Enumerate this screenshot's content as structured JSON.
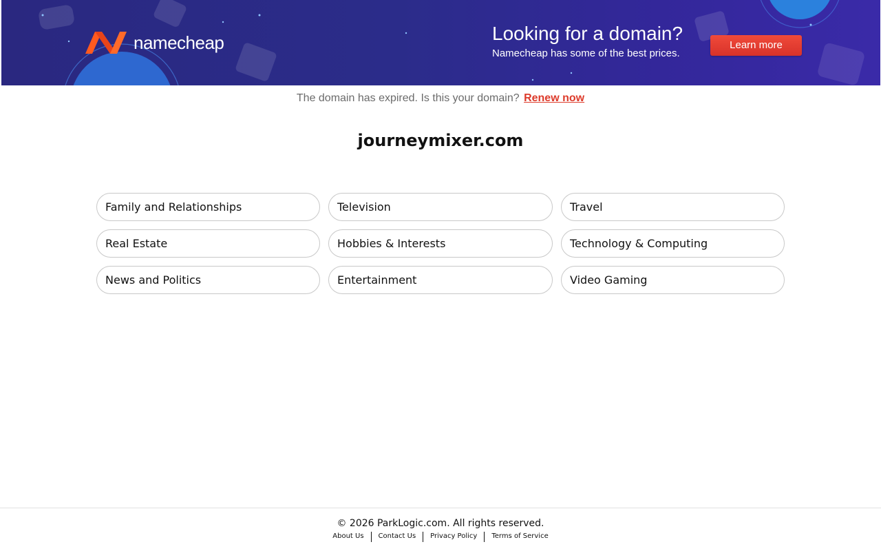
{
  "banner": {
    "brand_name": "namecheap",
    "logo_icon": "namecheap-logo-icon",
    "headline": "Looking for a domain?",
    "subline": "Namecheap has some of the best prices.",
    "cta_label": "Learn more",
    "colors": {
      "background": "#2b2c8a",
      "cta": "#e03a2e",
      "logo_orange": "#ff5a1f"
    }
  },
  "notice": {
    "text": "The domain has expired. Is this your domain?",
    "link_label": "Renew now",
    "link_color": "#dd3b2b"
  },
  "domain": "journeymixer.com",
  "categories": [
    "Family and Relationships",
    "Television",
    "Travel",
    "Real Estate",
    "Hobbies & Interests",
    "Technology & Computing",
    "News and Politics",
    "Entertainment",
    "Video Gaming"
  ],
  "footer": {
    "copyright": "© 2026 ParkLogic.com. All rights reserved.",
    "links": [
      "About Us",
      "Contact Us",
      "Privacy Policy",
      "Terms of Service"
    ]
  }
}
